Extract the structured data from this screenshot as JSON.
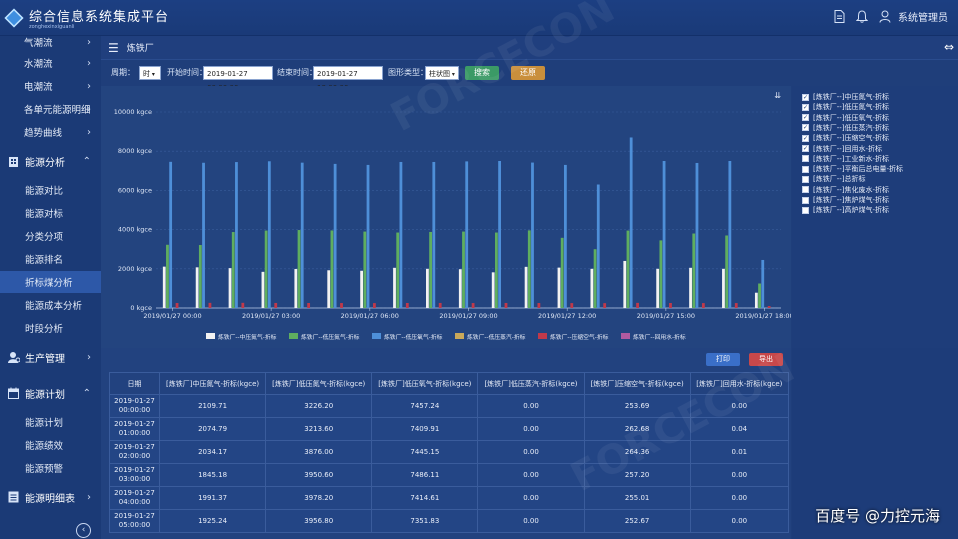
{
  "app": {
    "title": "综合信息系统集成平台",
    "subtitle": "zonghexinxiguanli",
    "user": "系统管理员"
  },
  "sidebar": {
    "items": [
      {
        "label": "气潮流"
      },
      {
        "label": "水潮流"
      },
      {
        "label": "电潮流"
      },
      {
        "label": "各单元能源明细"
      },
      {
        "label": "趋势曲线"
      }
    ],
    "groups": {
      "energy_analysis": "能源分析",
      "production": "生产管理",
      "energy_plan": "能源计划",
      "energy_report": "能源明细表"
    },
    "analysis_items": [
      {
        "label": "能源对比"
      },
      {
        "label": "能源对标"
      },
      {
        "label": "分类分项"
      },
      {
        "label": "能源排名"
      },
      {
        "label": "折标煤分析"
      },
      {
        "label": "能源成本分析"
      },
      {
        "label": "时段分析"
      }
    ],
    "plan_items": [
      {
        "label": "能源计划"
      },
      {
        "label": "能源绩效"
      },
      {
        "label": "能源预警"
      }
    ]
  },
  "breadcrumb": {
    "title": "炼铁厂"
  },
  "filters": {
    "period_label": "周期：",
    "period_value": "时",
    "start_label": "开始时间：",
    "start_value": "2019-01-27 00:00:00",
    "end_label": "结束时间：",
    "end_value": "2019-01-27 18:00:00",
    "chart_type_label": "图形类型：",
    "chart_type_value": "柱状图",
    "search": "搜索",
    "reset": "还原"
  },
  "chart_data": {
    "type": "bar",
    "ylim": [
      0,
      10000
    ],
    "yticks": [
      "0 kgce",
      "2000 kgce",
      "4000 kgce",
      "6000 kgce",
      "8000 kgce",
      "10000 kgce"
    ],
    "xticks": [
      "2019/01/27 00:00",
      "2019/01/27 03:00",
      "2019/01/27 06:00",
      "2019/01/27 09:00",
      "2019/01/27 12:00",
      "2019/01/27 15:00",
      "2019/01/27 18:00"
    ],
    "series": [
      {
        "name": "炼铁厂--中压氮气-折标",
        "color": "#f2f2f2",
        "values": [
          2110,
          2075,
          2034,
          1845,
          1992,
          1925,
          1900,
          2050,
          2000,
          1980,
          1820,
          2100,
          2060,
          2000,
          2400,
          2000,
          2050,
          2000,
          780
        ]
      },
      {
        "name": "炼铁厂--低压氮气-折标",
        "color": "#5fae5f",
        "values": [
          3226,
          3214,
          3876,
          3951,
          3978,
          3957,
          3900,
          3850,
          3880,
          3900,
          3850,
          3960,
          3580,
          3000,
          3950,
          3450,
          3800,
          3700,
          1250
        ]
      },
      {
        "name": "炼铁厂--低压氧气-折标",
        "color": "#4e8fd8",
        "values": [
          7457,
          7410,
          7445,
          7486,
          7415,
          7352,
          7300,
          7450,
          7450,
          7480,
          7500,
          7420,
          7300,
          6300,
          8700,
          7500,
          7400,
          7500,
          2450
        ]
      },
      {
        "name": "炼铁厂--低压蒸汽-折标",
        "color": "#c9a85a",
        "values": [
          0,
          0,
          0,
          0,
          0,
          0,
          0,
          0,
          0,
          0,
          0,
          0,
          0,
          0,
          0,
          0,
          0,
          0,
          0
        ]
      },
      {
        "name": "炼铁厂--压缩空气-折标",
        "color": "#c0394a",
        "values": [
          254,
          263,
          264,
          257,
          255,
          253,
          250,
          255,
          258,
          252,
          256,
          254,
          250,
          248,
          262,
          255,
          250,
          252,
          100
        ]
      },
      {
        "name": "炼铁厂--回用水-折标",
        "color": "#b05aa0",
        "values": [
          0,
          0.04,
          0.01,
          0,
          0,
          0,
          0,
          0,
          0,
          0,
          0,
          0,
          0,
          0,
          0,
          0,
          0,
          0,
          0
        ]
      }
    ]
  },
  "legend_list": [
    {
      "label": "[炼铁厂--]中压氮气-折标",
      "checked": "✓"
    },
    {
      "label": "[炼铁厂--]低压氮气-折标",
      "checked": "✓"
    },
    {
      "label": "[炼铁厂--]低压氧气-折标",
      "checked": "✓"
    },
    {
      "label": "[炼铁厂--]低压蒸汽-折标",
      "checked": "✓"
    },
    {
      "label": "[炼铁厂--]压缩空气-折标",
      "checked": "✓"
    },
    {
      "label": "[炼铁厂--]回用水-折标",
      "checked": "✓"
    },
    {
      "label": "[炼铁厂--]工业新水-折标",
      "checked": ""
    },
    {
      "label": "[炼铁厂--]平衡后总电量-折标",
      "checked": ""
    },
    {
      "label": "[炼铁厂--]总折标",
      "checked": ""
    },
    {
      "label": "[炼铁厂--]焦化废水-折标",
      "checked": ""
    },
    {
      "label": "[炼铁厂--]焦炉煤气-折标",
      "checked": ""
    },
    {
      "label": "[炼铁厂--]高炉煤气-折标",
      "checked": ""
    }
  ],
  "table": {
    "print": "打印",
    "export": "导出",
    "headers": [
      "日期",
      "[炼铁厂]中压氮气-折标(kgce)",
      "[炼铁厂]低压氮气-折标(kgce)",
      "[炼铁厂]低压氧气-折标(kgce)",
      "[炼铁厂]低压蒸汽-折标(kgce)",
      "[炼铁厂]压缩空气-折标(kgce)",
      "[炼铁厂]回用水-折标(kgce)"
    ],
    "rows": [
      [
        "2019-01-27",
        "00:00:00",
        "2109.71",
        "3226.20",
        "7457.24",
        "0.00",
        "253.69",
        "0.00"
      ],
      [
        "2019-01-27",
        "01:00:00",
        "2074.79",
        "3213.60",
        "7409.91",
        "0.00",
        "262.68",
        "0.04"
      ],
      [
        "2019-01-27",
        "02:00:00",
        "2034.17",
        "3876.00",
        "7445.15",
        "0.00",
        "264.36",
        "0.01"
      ],
      [
        "2019-01-27",
        "03:00:00",
        "1845.18",
        "3950.60",
        "7486.11",
        "0.00",
        "257.20",
        "0.00"
      ],
      [
        "2019-01-27",
        "04:00:00",
        "1991.37",
        "3978.20",
        "7414.61",
        "0.00",
        "255.01",
        "0.00"
      ],
      [
        "2019-01-27",
        "05:00:00",
        "1925.24",
        "3956.80",
        "7351.83",
        "0.00",
        "252.67",
        "0.00"
      ]
    ]
  },
  "overlay_caption": "百度号 @力控元海",
  "watermark": "FORCECON"
}
